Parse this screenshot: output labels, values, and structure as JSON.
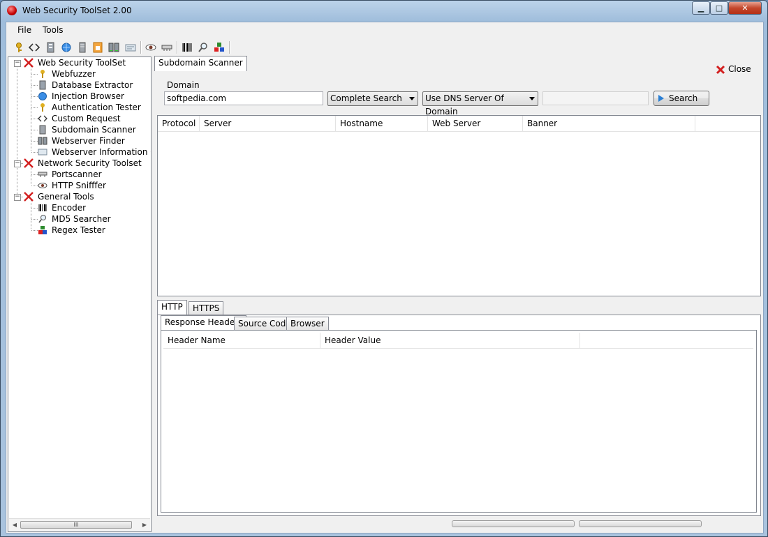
{
  "window": {
    "title": "Web Security ToolSet 2.00",
    "controls": {
      "minimize": "▁",
      "maximize": "□",
      "close": "✕"
    }
  },
  "menu": {
    "file": "File",
    "tools": "Tools"
  },
  "toolbar": {
    "icons": [
      "key-icon",
      "code-icon",
      "database-icon",
      "globe-icon",
      "server-icon",
      "lock-icon",
      "servers-icon",
      "info-card-icon",
      "eye-icon",
      "network-icon",
      "barcode-icon",
      "magnifier-icon",
      "blocks-icon"
    ]
  },
  "tree": {
    "groups": [
      {
        "label": "Web Security ToolSet",
        "children": [
          "Webfuzzer",
          "Database Extractor",
          "Injection Browser",
          "Authentication Tester",
          "Custom Request",
          "Subdomain Scanner",
          "Webserver Finder",
          "Webserver Information Catcher"
        ]
      },
      {
        "label": "Network Security Toolset",
        "children": [
          "Portscanner",
          "HTTP Snifffer"
        ]
      },
      {
        "label": "General Tools",
        "children": [
          "Encoder",
          "MD5 Searcher",
          "Regex Tester"
        ]
      }
    ],
    "scroll_thumb": "III"
  },
  "main": {
    "active_tab": "Subdomain Scanner",
    "close_label": "Close",
    "domain_label": "Domain",
    "domain_value": "softpedia.com",
    "search_mode": "Complete Search",
    "dns_option": "Use DNS Server Of Domain",
    "search_button": "Search",
    "results_columns": [
      "Protocol",
      "Server",
      "Hostname",
      "Web Server",
      "Banner"
    ],
    "protocol_tabs": [
      "HTTP",
      "HTTPS"
    ],
    "detail_tabs": [
      "Response Headers",
      "Source Code",
      "Browser"
    ],
    "header_columns": [
      "Header Name",
      "Header Value"
    ]
  },
  "colors": {
    "accent_red": "#d32020",
    "window_frame": "#a9c3de"
  }
}
